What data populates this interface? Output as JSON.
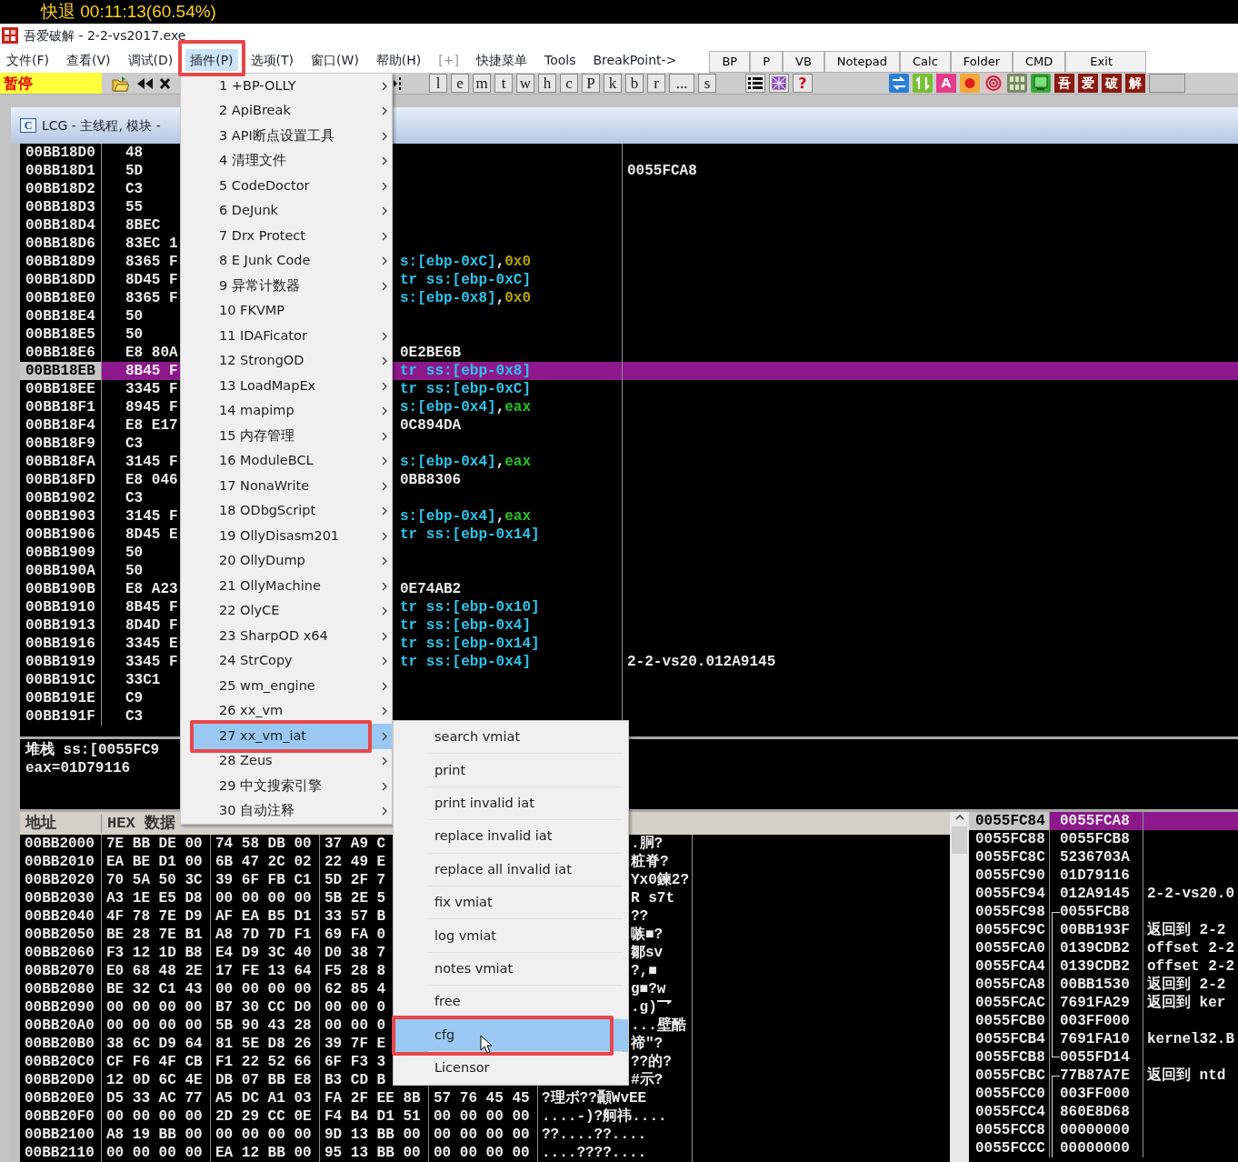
{
  "overlay_text": "快退 00:11:13(60.54%)",
  "window": {
    "title": "吾爱破解 - 2-2-vs2017.exe"
  },
  "menubar": [
    {
      "label": "文件(F)",
      "selected": false,
      "disabled": false
    },
    {
      "label": "查看(V)",
      "selected": false,
      "disabled": false
    },
    {
      "label": "调试(D)",
      "selected": false,
      "disabled": false
    },
    {
      "label": "插件(P)",
      "selected": true,
      "disabled": false
    },
    {
      "label": "选项(T)",
      "selected": false,
      "disabled": false
    },
    {
      "label": "窗口(W)",
      "selected": false,
      "disabled": false
    },
    {
      "label": "帮助(H)",
      "selected": false,
      "disabled": false
    },
    {
      "label": "[+]",
      "selected": false,
      "disabled": true
    },
    {
      "label": "快捷菜单",
      "selected": false,
      "disabled": false
    },
    {
      "label": "Tools",
      "selected": false,
      "disabled": false
    },
    {
      "label": "BreakPoint->",
      "selected": false,
      "disabled": false
    }
  ],
  "quick_buttons": [
    "BP",
    "P",
    "VB",
    "Notepad",
    "Calc",
    "Folder",
    "CMD",
    "Exit"
  ],
  "toolbar": {
    "status": "暂停",
    "letters": [
      "l",
      "e",
      "m",
      "t",
      "w",
      "h",
      "c",
      "P",
      "k",
      "b",
      "r",
      "...",
      "s"
    ],
    "help": "?",
    "tiles": [
      {
        "kind": "swap"
      },
      {
        "kind": "updown"
      },
      {
        "kind": "letter",
        "text": "A"
      },
      {
        "kind": "dot"
      },
      {
        "kind": "target"
      },
      {
        "kind": "chip"
      },
      {
        "kind": "board"
      },
      {
        "kind": "char",
        "text": "吾"
      },
      {
        "kind": "char",
        "text": "爱"
      },
      {
        "kind": "char",
        "text": "破"
      },
      {
        "kind": "char",
        "text": "解"
      },
      {
        "kind": "blank"
      }
    ]
  },
  "cpu_window": {
    "icon_letter": "C",
    "title": "LCG - 主线程, 模块 -"
  },
  "disasm": {
    "rows": [
      {
        "address": "00BB18D0",
        "hex": "48",
        "selected": false
      },
      {
        "address": "00BB18D1",
        "hex": "5D",
        "comment": "0055FCA8",
        "selected": false
      },
      {
        "address": "00BB18D2",
        "hex": "C3",
        "selected": false
      },
      {
        "address": "00BB18D3",
        "hex": "55",
        "selected": false
      },
      {
        "address": "00BB18D4",
        "hex": "8BEC",
        "selected": false
      },
      {
        "address": "00BB18D6",
        "hex": "83EC 1",
        "selected": false
      },
      {
        "address": "00BB18D9",
        "hex": "8365 F",
        "asm": [
          {
            "kind": "mem",
            "text": "s:[ebp-0xC]"
          },
          {
            "kind": "plain",
            "text": ","
          },
          {
            "kind": "imm",
            "text": "0x0"
          }
        ],
        "selected": false
      },
      {
        "address": "00BB18DD",
        "hex": "8D45 F",
        "asm": [
          {
            "kind": "mem",
            "text": "tr ss:[ebp-0xC]"
          }
        ],
        "selected": false
      },
      {
        "address": "00BB18E0",
        "hex": "8365 F",
        "asm": [
          {
            "kind": "mem",
            "text": "s:[ebp-0x8]"
          },
          {
            "kind": "plain",
            "text": ","
          },
          {
            "kind": "imm",
            "text": "0x0"
          }
        ],
        "selected": false
      },
      {
        "address": "00BB18E4",
        "hex": "50",
        "selected": false
      },
      {
        "address": "00BB18E5",
        "hex": "50",
        "selected": false
      },
      {
        "address": "00BB18E6",
        "hex": "E8 80A",
        "asm": [
          {
            "kind": "plain",
            "text": "0E2BE6B"
          }
        ],
        "selected": false
      },
      {
        "address": "00BB18EB",
        "hex": "8B45 F",
        "asm": [
          {
            "kind": "mem",
            "text": "tr ss:[ebp-0x8]"
          }
        ],
        "selected": true
      },
      {
        "address": "00BB18EE",
        "hex": "3345 F",
        "asm": [
          {
            "kind": "mem",
            "text": "tr ss:[ebp-0xC]"
          }
        ],
        "selected": false
      },
      {
        "address": "00BB18F1",
        "hex": "8945 F",
        "asm": [
          {
            "kind": "mem",
            "text": "s:[ebp-0x4]"
          },
          {
            "kind": "plain",
            "text": ","
          },
          {
            "kind": "reg",
            "text": "eax"
          }
        ],
        "selected": false
      },
      {
        "address": "00BB18F4",
        "hex": "E8 E17",
        "asm": [
          {
            "kind": "plain",
            "text": "0C894DA"
          }
        ],
        "selected": false
      },
      {
        "address": "00BB18F9",
        "hex": "C3",
        "selected": false
      },
      {
        "address": "00BB18FA",
        "hex": "3145 F",
        "asm": [
          {
            "kind": "mem",
            "text": "s:[ebp-0x4]"
          },
          {
            "kind": "plain",
            "text": ","
          },
          {
            "kind": "reg",
            "text": "eax"
          }
        ],
        "selected": false
      },
      {
        "address": "00BB18FD",
        "hex": "E8 046",
        "asm": [
          {
            "kind": "plain",
            "text": "0BB8306"
          }
        ],
        "selected": false
      },
      {
        "address": "00BB1902",
        "hex": "C3",
        "selected": false
      },
      {
        "address": "00BB1903",
        "hex": "3145 F",
        "asm": [
          {
            "kind": "mem",
            "text": "s:[ebp-0x4]"
          },
          {
            "kind": "plain",
            "text": ","
          },
          {
            "kind": "reg",
            "text": "eax"
          }
        ],
        "selected": false
      },
      {
        "address": "00BB1906",
        "hex": "8D45 E",
        "asm": [
          {
            "kind": "mem",
            "text": "tr ss:[ebp-0x14]"
          }
        ],
        "selected": false
      },
      {
        "address": "00BB1909",
        "hex": "50",
        "selected": false
      },
      {
        "address": "00BB190A",
        "hex": "50",
        "selected": false
      },
      {
        "address": "00BB190B",
        "hex": "E8 A23",
        "asm": [
          {
            "kind": "plain",
            "text": "0E74AB2"
          }
        ],
        "selected": false
      },
      {
        "address": "00BB1910",
        "hex": "8B45 F",
        "asm": [
          {
            "kind": "mem",
            "text": "tr ss:[ebp-0x10]"
          }
        ],
        "selected": false
      },
      {
        "address": "00BB1913",
        "hex": "8D4D F",
        "asm": [
          {
            "kind": "mem",
            "text": "tr ss:[ebp-0x4]"
          }
        ],
        "selected": false
      },
      {
        "address": "00BB1916",
        "hex": "3345 E",
        "asm": [
          {
            "kind": "mem",
            "text": "tr ss:[ebp-0x14]"
          }
        ],
        "selected": false
      },
      {
        "address": "00BB1919",
        "hex": "3345 F",
        "asm": [
          {
            "kind": "mem",
            "text": "tr ss:[ebp-0x4]"
          }
        ],
        "comment": "2-2-vs20.012A9145",
        "selected": false
      },
      {
        "address": "00BB191C",
        "hex": "33C1",
        "selected": false
      },
      {
        "address": "00BB191E",
        "hex": "C9",
        "selected": false
      },
      {
        "address": "00BB191F",
        "hex": "C3",
        "selected": false
      }
    ]
  },
  "info": [
    "堆栈 ss:[0055FC9",
    "eax=01D79116"
  ],
  "dump": {
    "columns": [
      "地址",
      "HEX 数据"
    ],
    "rows": [
      {
        "address": "00BB2000",
        "hex": [
          "7E BB DE 00",
          "74 58 DB 00",
          "37 A9 C"
        ],
        "ascii": ".胴?"
      },
      {
        "address": "00BB2010",
        "hex": [
          "EA BE D1 00",
          "6B 47 2C 02",
          "22 49 E"
        ],
        "ascii": "粧脊?"
      },
      {
        "address": "00BB2020",
        "hex": [
          "70 5A 50 3C",
          "39 6F FB C1",
          "5D 2F 7"
        ],
        "ascii": "Yx0鍊2?"
      },
      {
        "address": "00BB2030",
        "hex": [
          "A3 1E E5 D8",
          "00 00 00 00",
          "5B 2E 5"
        ],
        "ascii": "R  s7t"
      },
      {
        "address": "00BB2040",
        "hex": [
          "4F 78 7E D9",
          "AF EA B5 D1",
          "33 57 B"
        ],
        "ascii": "??"
      },
      {
        "address": "00BB2050",
        "hex": [
          "BE 28 7E B1",
          "A8 7D 7D F1",
          "69 FA 0"
        ],
        "ascii": "嗾■?"
      },
      {
        "address": "00BB2060",
        "hex": [
          "F3 12 1D B8",
          "E4 D9 3C 40",
          "D0 38 7"
        ],
        "ascii": "鄒sv"
      },
      {
        "address": "00BB2070",
        "hex": [
          "E0 68 48 2E",
          "17 FE 13 64",
          "F5 28 8"
        ],
        "ascii": "?,■"
      },
      {
        "address": "00BB2080",
        "hex": [
          "BE 32 C1 43",
          "00 00 00 00",
          "62 85 4"
        ],
        "ascii": "g■?w"
      },
      {
        "address": "00BB2090",
        "hex": [
          "00 00 00 00",
          "B7 30 CC D0",
          "00 00 0"
        ],
        "ascii": ".g)乛"
      },
      {
        "address": "00BB20A0",
        "hex": [
          "00 00 00 00",
          "5B 90 43 28",
          "00 00 0"
        ],
        "ascii": "...壁酷"
      },
      {
        "address": "00BB20B0",
        "hex": [
          "38 6C D9 64",
          "81 5E D8 26",
          "39 7F E"
        ],
        "ascii": "禘\"?"
      },
      {
        "address": "00BB20C0",
        "hex": [
          "CF F6 4F CB",
          "F1 22 52 66",
          "6F F3 3"
        ],
        "ascii": "??的?"
      },
      {
        "address": "00BB20D0",
        "hex": [
          "12 0D 6C 4E",
          "DB 07 BB E8",
          "B3 CD B"
        ],
        "ascii": "#示?"
      },
      {
        "address": "00BB20E0",
        "hex": [
          "D5 33 AC 77",
          "A5 DC A1 03",
          "FA 2F EE 8B",
          "57 76 45 45"
        ],
        "ascii": "?理ボ??顳WvEE"
      },
      {
        "address": "00BB20F0",
        "hex": [
          "00 00 00 00",
          "2D 29 CC 0E",
          "F4 B4 D1 51",
          "00 00 00 00"
        ],
        "ascii": "....-)?舸祎...."
      },
      {
        "address": "00BB2100",
        "hex": [
          "A8 19 BB 00",
          "00 00 00 00",
          "9D 13 BB 00",
          "00 00 00 00"
        ],
        "ascii": "??....??...."
      },
      {
        "address": "00BB2110",
        "hex": [
          "00 00 00 00",
          "EA 12 BB 00",
          "95 13 BB 00",
          "00 00 00 00"
        ],
        "ascii": "....????...."
      }
    ]
  },
  "stack": {
    "rows": [
      {
        "kind": "plain",
        "address": "0055FC84",
        "value": "0055FCA8",
        "selected": true
      },
      {
        "kind": "plain",
        "address": "0055FC88",
        "value": "0055FCB8",
        "selected": false
      },
      {
        "kind": "plain",
        "address": "0055FC8C",
        "value": "5236703A",
        "selected": false
      },
      {
        "kind": "plain",
        "address": "0055FC90",
        "value": "01D79116",
        "selected": false
      },
      {
        "kind": "plain",
        "address": "0055FC94",
        "value": "012A9145",
        "comment": "2-2-vs20.0",
        "selected": false
      },
      {
        "kind": "frame_start",
        "address": "0055FC98",
        "value": "0055FCB8",
        "selected": false
      },
      {
        "kind": "frame_body",
        "address": "0055FC9C",
        "value": "00BB193F",
        "comment": "返回到 2-2",
        "selected": false
      },
      {
        "kind": "frame_body",
        "address": "0055FCA0",
        "value": "0139CDB2",
        "comment": "offset 2-2",
        "selected": false
      },
      {
        "kind": "frame_body",
        "address": "0055FCA4",
        "value": "0139CDB2",
        "comment": "offset 2-2",
        "selected": false
      },
      {
        "kind": "frame_body",
        "address": "0055FCA8",
        "value": "00BB1530",
        "comment": "返回到 2-2",
        "selected": false
      },
      {
        "kind": "frame_body",
        "address": "0055FCAC",
        "value": "7691FA29",
        "comment": "返回到 ker",
        "selected": false
      },
      {
        "kind": "frame_body",
        "address": "0055FCB0",
        "value": "003FF000",
        "selected": false
      },
      {
        "kind": "frame_body",
        "address": "0055FCB4",
        "value": "7691FA10",
        "comment": "kernel32.B",
        "selected": false
      },
      {
        "kind": "frame_end",
        "address": "0055FCB8",
        "value": "0055FD14",
        "selected": false
      },
      {
        "kind": "frame_start",
        "address": "0055FCBC",
        "value": "77B87A7E",
        "comment": "返回到 ntd",
        "selected": false
      },
      {
        "kind": "frame_body",
        "address": "0055FCC0",
        "value": "003FF000",
        "selected": false
      },
      {
        "kind": "frame_body",
        "address": "0055FCC4",
        "value": "860E8D68",
        "selected": false
      },
      {
        "kind": "frame_body",
        "address": "0055FCC8",
        "value": "00000000",
        "selected": false
      },
      {
        "kind": "frame_body",
        "address": "0055FCCC",
        "value": "00000000",
        "selected": false
      }
    ]
  },
  "plugin_menu": {
    "items": [
      {
        "label": "1 +BP-OLLY",
        "submenu": true,
        "selected": false
      },
      {
        "label": "2 ApiBreak",
        "submenu": true,
        "selected": false
      },
      {
        "label": "3 API断点设置工具",
        "submenu": true,
        "selected": false
      },
      {
        "label": "4 清理文件",
        "submenu": true,
        "selected": false
      },
      {
        "label": "5 CodeDoctor",
        "submenu": true,
        "selected": false
      },
      {
        "label": "6 DeJunk",
        "submenu": true,
        "selected": false
      },
      {
        "label": "7 Drx Protect",
        "submenu": true,
        "selected": false
      },
      {
        "label": "8 E Junk Code",
        "submenu": true,
        "selected": false
      },
      {
        "label": "9 异常计数器",
        "submenu": true,
        "selected": false
      },
      {
        "label": "10 FKVMP",
        "submenu": false,
        "selected": false
      },
      {
        "label": "11 IDAFicator",
        "submenu": true,
        "selected": false
      },
      {
        "label": "12 StrongOD",
        "submenu": true,
        "selected": false
      },
      {
        "label": "13 LoadMapEx",
        "submenu": true,
        "selected": false
      },
      {
        "label": "14 mapimp",
        "submenu": true,
        "selected": false
      },
      {
        "label": "15 内存管理",
        "submenu": true,
        "selected": false
      },
      {
        "label": "16 ModuleBCL",
        "submenu": true,
        "selected": false
      },
      {
        "label": "17 NonaWrite",
        "submenu": true,
        "selected": false
      },
      {
        "label": "18 ODbgScript",
        "submenu": true,
        "selected": false
      },
      {
        "label": "19 OllyDisasm201",
        "submenu": true,
        "selected": false
      },
      {
        "label": "20 OllyDump",
        "submenu": true,
        "selected": false
      },
      {
        "label": "21 OllyMachine",
        "submenu": true,
        "selected": false
      },
      {
        "label": "22 OlyCE",
        "submenu": true,
        "selected": false
      },
      {
        "label": "23 SharpOD x64",
        "submenu": true,
        "selected": false
      },
      {
        "label": "24 StrCopy",
        "submenu": true,
        "selected": false
      },
      {
        "label": "25 wm_engine",
        "submenu": true,
        "selected": false
      },
      {
        "label": "26 xx_vm",
        "submenu": true,
        "selected": false
      },
      {
        "label": "27 xx_vm_iat",
        "submenu": true,
        "selected": true
      },
      {
        "label": "28 Zeus",
        "submenu": true,
        "selected": false
      },
      {
        "label": "29 中文搜索引擎",
        "submenu": true,
        "selected": false
      },
      {
        "label": "30 自动注释",
        "submenu": true,
        "selected": false
      }
    ]
  },
  "submenu": {
    "items": [
      {
        "label": "search vmiat",
        "selected": false
      },
      {
        "label": "print",
        "selected": false
      },
      {
        "label": "print invalid iat",
        "selected": false
      },
      {
        "label": "replace invalid iat",
        "selected": false
      },
      {
        "label": "replace all invalid iat",
        "selected": false
      },
      {
        "label": "fix vmiat",
        "selected": false
      },
      {
        "label": "log vmiat",
        "selected": false
      },
      {
        "label": "notes vmiat",
        "selected": false
      },
      {
        "label": "free",
        "selected": false
      },
      {
        "label": "cfg",
        "selected": true
      },
      {
        "label": "Licensor",
        "selected": false
      }
    ]
  }
}
